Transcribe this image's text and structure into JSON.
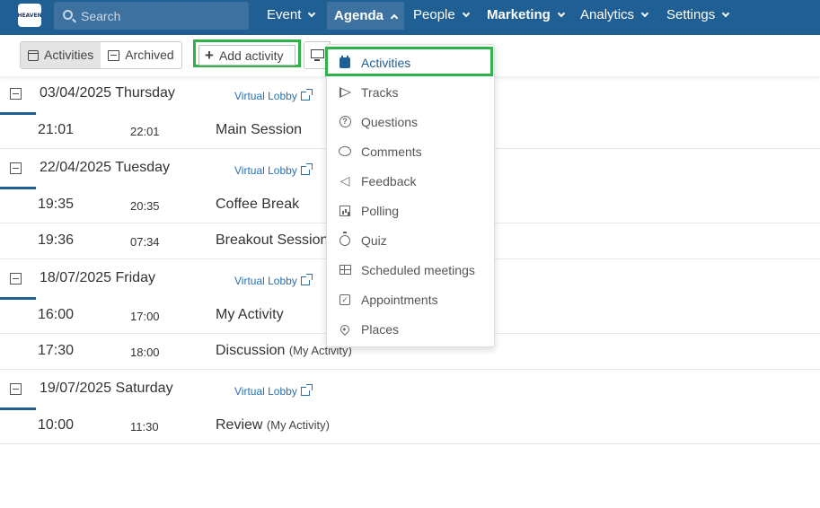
{
  "nav": {
    "logo_text": "HEAVEN",
    "search_placeholder": "Search",
    "items": [
      {
        "label": "Event"
      },
      {
        "label": "Agenda"
      },
      {
        "label": "People"
      },
      {
        "label": "Marketing"
      },
      {
        "label": "Analytics"
      },
      {
        "label": "Settings"
      }
    ]
  },
  "toolbar": {
    "activities_label": "Activities",
    "archived_label": "Archived",
    "add_label": "Add activity"
  },
  "agenda_dropdown": {
    "items": [
      {
        "label": "Activities",
        "icon": "calendar-icon"
      },
      {
        "label": "Tracks",
        "icon": "flag-icon"
      },
      {
        "label": "Questions",
        "icon": "question-icon"
      },
      {
        "label": "Comments",
        "icon": "comment-icon"
      },
      {
        "label": "Feedback",
        "icon": "megaphone-icon"
      },
      {
        "label": "Polling",
        "icon": "chart-icon"
      },
      {
        "label": "Quiz",
        "icon": "stopwatch-icon"
      },
      {
        "label": "Scheduled meetings",
        "icon": "table-icon"
      },
      {
        "label": "Appointments",
        "icon": "calendar-check-icon"
      },
      {
        "label": "Places",
        "icon": "map-pin-icon"
      }
    ]
  },
  "days": [
    {
      "date": "03/04/2025 Thursday",
      "lobby": "Virtual Lobby",
      "activities": [
        {
          "start": "21:01",
          "end": "22:01",
          "title": "Main Session",
          "sub": ""
        }
      ]
    },
    {
      "date": "22/04/2025 Tuesday",
      "lobby": "Virtual Lobby",
      "activities": [
        {
          "start": "19:35",
          "end": "20:35",
          "title": "Coffee Break",
          "sub": ""
        },
        {
          "start": "19:36",
          "end": "07:34",
          "title": "Breakout Session",
          "sub": ""
        }
      ]
    },
    {
      "date": "18/07/2025 Friday",
      "lobby": "Virtual Lobby",
      "activities": [
        {
          "start": "16:00",
          "end": "17:00",
          "title": "My Activity",
          "sub": ""
        },
        {
          "start": "17:30",
          "end": "18:00",
          "title": "Discussion",
          "sub": "(My Activity)"
        }
      ]
    },
    {
      "date": "19/07/2025 Saturday",
      "lobby": "Virtual Lobby",
      "activities": [
        {
          "start": "10:00",
          "end": "11:30",
          "title": "Review",
          "sub": "(My Activity)"
        }
      ]
    }
  ],
  "colors": {
    "nav_bg": "#1f5f94",
    "highlight": "#2db34a",
    "link": "#2a6fb0"
  }
}
